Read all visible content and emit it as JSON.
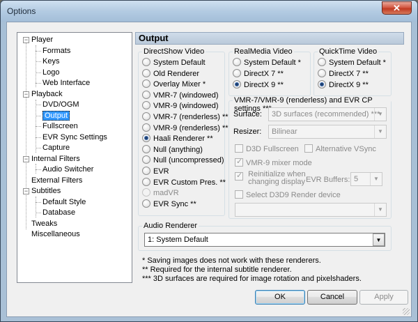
{
  "window": {
    "title": "Options",
    "close": "✕"
  },
  "tree": {
    "items": [
      {
        "label": "Player",
        "level": 0
      },
      {
        "label": "Formats",
        "level": 1
      },
      {
        "label": "Keys",
        "level": 1
      },
      {
        "label": "Logo",
        "level": 1
      },
      {
        "label": "Web Interface",
        "level": 1
      },
      {
        "label": "Playback",
        "level": 0
      },
      {
        "label": "DVD/OGM",
        "level": 1
      },
      {
        "label": "Output",
        "level": 1,
        "selected": true
      },
      {
        "label": "Fullscreen",
        "level": 1
      },
      {
        "label": "EVR Sync Settings",
        "level": 1
      },
      {
        "label": "Capture",
        "level": 1
      },
      {
        "label": "Internal Filters",
        "level": 0
      },
      {
        "label": "Audio Switcher",
        "level": 1
      },
      {
        "label": "External Filters",
        "level": 0
      },
      {
        "label": "Subtitles",
        "level": 0
      },
      {
        "label": "Default Style",
        "level": 1
      },
      {
        "label": "Database",
        "level": 1
      },
      {
        "label": "Tweaks",
        "level": 0
      },
      {
        "label": "Miscellaneous",
        "level": 0
      }
    ]
  },
  "panel": {
    "title": "Output"
  },
  "directshow": {
    "label": "DirectShow Video",
    "options": [
      "System Default",
      "Old Renderer",
      "Overlay Mixer *",
      "VMR-7 (windowed)",
      "VMR-9 (windowed)",
      "VMR-7 (renderless) **",
      "VMR-9 (renderless) **",
      "Haali Renderer **",
      "Null (anything)",
      "Null (uncompressed)",
      "EVR",
      "EVR Custom Pres. **",
      "madVR",
      "EVR Sync **"
    ],
    "selected": "Haali Renderer **",
    "disabled": [
      "madVR"
    ]
  },
  "realmedia": {
    "label": "RealMedia Video",
    "options": [
      "System Default *",
      "DirectX 7 **",
      "DirectX 9 **"
    ],
    "selected": "DirectX 9 **"
  },
  "quicktime": {
    "label": "QuickTime Video",
    "options": [
      "System Default *",
      "DirectX 7 **",
      "DirectX 9 **"
    ],
    "selected": "DirectX 9 **"
  },
  "vmr": {
    "label": "VMR-7/VMR-9 (renderless) and EVR CP settings ***",
    "surface_label": "Surface:",
    "surface_value": "3D surfaces (recommended) ***",
    "resizer_label": "Resizer:",
    "resizer_value": "Bilinear",
    "d3d_fullscreen": "D3D Fullscreen",
    "alt_vsync": "Alternative VSync",
    "mixer_mode": "VMR-9 mixer mode",
    "reinit_line1": "Reinitialize when",
    "reinit_line2": "changing display",
    "evr_buffers_label": "EVR Buffers:",
    "evr_buffers_value": "5",
    "select_d3d9": "Select D3D9 Render device",
    "device_value": ""
  },
  "audio": {
    "label": "Audio Renderer",
    "value": "1: System Default"
  },
  "notes": [
    "* Saving images does not work with these renderers.",
    "** Required for the internal subtitle renderer.",
    "*** 3D surfaces are required for image rotation and pixelshaders."
  ],
  "buttons": {
    "ok": "OK",
    "cancel": "Cancel",
    "apply": "Apply"
  }
}
